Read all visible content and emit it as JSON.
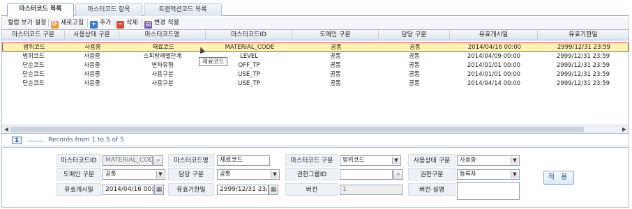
{
  "tabs": [
    {
      "label": "마스터코드 목록"
    },
    {
      "label": "마스터코드 항목"
    },
    {
      "label": "트랜잭션코드 목록"
    }
  ],
  "toolbar": {
    "column_view": "컬럼 보기 설정",
    "refresh": "새로고침",
    "add": "추가",
    "delete": "삭제",
    "apply_changes": "변경 적용"
  },
  "grid": {
    "columns": [
      "마스터코드 구분",
      "사용상태 구분",
      "마스터코드명",
      "마스터코드ID",
      "도메인 구분",
      "담당 구분",
      "유효개시일",
      "유효기한일"
    ],
    "rows": [
      [
        "범위코드",
        "사용중",
        "재료코드",
        "MATERIAL_CODE",
        "공통",
        "공통",
        "2014/04/16 00:00",
        "2999/12/31 23:59"
      ],
      [
        "범위코드",
        "사용중",
        "스피탕래벨단계",
        "LEVEL",
        "공통",
        "공통",
        "2014/04/09 00:00",
        "2999/12/31 23:59"
      ],
      [
        "단순코드",
        "사용중",
        "연차유형",
        "OFF_TP",
        "공통",
        "공통",
        "2014/01/01 00:00",
        "2999/12/31 23:59"
      ],
      [
        "단순코드",
        "사용중",
        "사용구분",
        "USE_TP",
        "공통",
        "공통",
        "2014/01/01 00:00",
        "2999/12/31 23:59"
      ],
      [
        "단순코드",
        "사용중",
        "사용구분",
        "USE_TP",
        "공통",
        "공통",
        "2014/04/14 00:00",
        "2999/12/31 23:59"
      ]
    ],
    "tooltip": "재료코드"
  },
  "pager": {
    "page": "1",
    "records": "Records from 1 to 5 of 5"
  },
  "form": {
    "labels": {
      "master_code_id": "마스터코드ID",
      "master_code_name": "마스터코드명",
      "master_code_type": "마스터코드 구분",
      "use_status": "사용상태 구분",
      "domain_type": "도메인 구분",
      "owner_type": "담당 구분",
      "auth_group_id": "권한그룹ID",
      "auth_type": "권한구분",
      "valid_start": "유효개시일",
      "valid_end": "유효기한일",
      "version": "버전",
      "version_desc": "버전 설명"
    },
    "values": {
      "master_code_id": "MATERIAL_CODE",
      "master_code_name": "재료코드",
      "master_code_type": "범위코드",
      "use_status": "사용중",
      "domain_type": "공통",
      "owner_type": "공통",
      "auth_group_id": "",
      "auth_type": "등록자",
      "valid_start": "2014/04/16 00:00",
      "valid_end": "2999/12/31 23:59",
      "version": "1",
      "version_desc": ""
    },
    "apply_button": "적 용"
  }
}
